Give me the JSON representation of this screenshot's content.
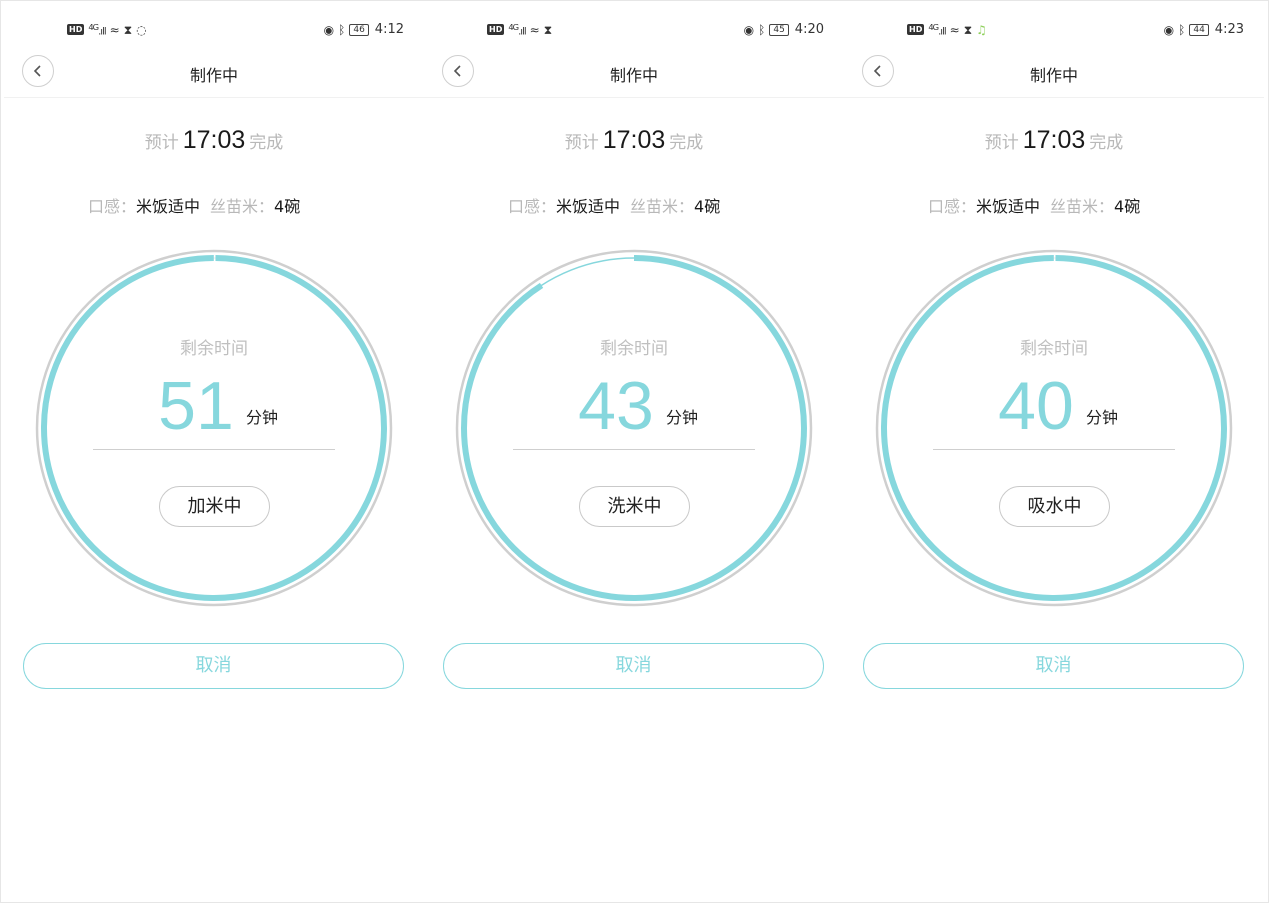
{
  "accent_color": "#86d7dd",
  "screens": [
    {
      "status": {
        "network": "4G",
        "battery": "46",
        "time": "4:12"
      },
      "title": "制作中",
      "eta": {
        "prefix": "预计",
        "time": "17:03",
        "suffix": "完成"
      },
      "texture_label": "口感：",
      "texture_value": "米饭适中",
      "rice_label": "丝苗米：",
      "rice_value": "4碗",
      "remaining_label": "剩余时间",
      "minutes": "51",
      "unit": "分钟",
      "stage": "加米中",
      "cancel": "取消"
    },
    {
      "status": {
        "network": "4G",
        "battery": "45",
        "time": "4:20"
      },
      "title": "制作中",
      "eta": {
        "prefix": "预计",
        "time": "17:03",
        "suffix": "完成"
      },
      "texture_label": "口感：",
      "texture_value": "米饭适中",
      "rice_label": "丝苗米：",
      "rice_value": "4碗",
      "remaining_label": "剩余时间",
      "minutes": "43",
      "unit": "分钟",
      "stage": "洗米中",
      "cancel": "取消"
    },
    {
      "status": {
        "network": "4G",
        "battery": "44",
        "time": "4:23"
      },
      "title": "制作中",
      "eta": {
        "prefix": "预计",
        "time": "17:03",
        "suffix": "完成"
      },
      "texture_label": "口感：",
      "texture_value": "米饭适中",
      "rice_label": "丝苗米：",
      "rice_value": "4碗",
      "remaining_label": "剩余时间",
      "minutes": "40",
      "unit": "分钟",
      "stage": "吸水中",
      "cancel": "取消"
    }
  ]
}
